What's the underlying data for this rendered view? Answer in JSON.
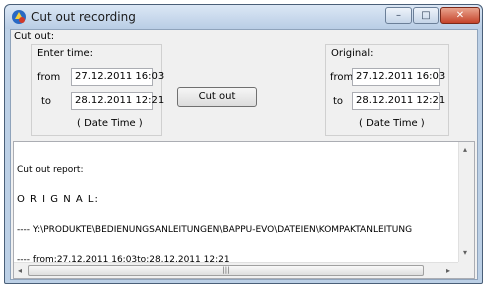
{
  "window": {
    "title": "Cut out recording",
    "min_glyph": "–",
    "max_glyph": "□",
    "close_glyph": "✕"
  },
  "cut_out": {
    "group_label": "Cut out:",
    "enter_time_label": "Enter time:",
    "from_label": "from",
    "to_label": "to",
    "from_value": "27.12.2011 16:03",
    "to_value": "28.12.2011 12:21",
    "format_hint": "(   Date  Time )"
  },
  "original": {
    "label": "Original:",
    "from_label": "from",
    "to_label": "to",
    "from_value": "27.12.2011 16:03",
    "to_value": "28.12.2011 12:21",
    "format_hint": "(   Date  Time )"
  },
  "actions": {
    "cut_out_button": "Cut out"
  },
  "report": {
    "label": "Cut out report:",
    "lines": [
      "O R I G N A L:",
      "---- Y:\\PRODUKTE\\BEDIENUNGSANLEITUNGEN\\BAPPU-EVO\\DATEIEN\\KOMPAKTANLEITUNG",
      "---- from:27.12.2011 16:03to:28.12.2011 12:21"
    ]
  },
  "scrollbars": {
    "up_glyph": "▴",
    "down_glyph": "▾",
    "left_glyph": "◂",
    "right_glyph": "▸",
    "grip_glyph": "|||"
  }
}
